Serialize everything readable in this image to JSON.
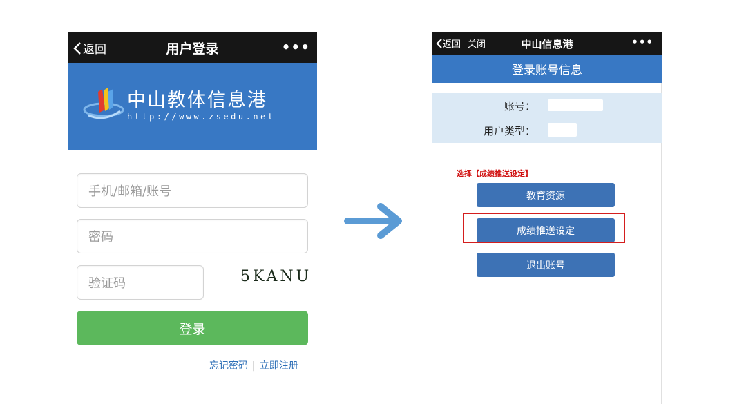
{
  "left_screen": {
    "nav": {
      "back_label": "返回",
      "title": "用户登录",
      "more": "•••"
    },
    "banner": {
      "brand": "中山教体信息港",
      "url": "http://www.zsedu.net"
    },
    "form": {
      "account_placeholder": "手机/邮箱/账号",
      "password_placeholder": "密码",
      "captcha_placeholder": "验证码",
      "captcha_text": "5KANU",
      "login_label": "登录"
    },
    "links": {
      "forgot": "忘记密码",
      "separator": "|",
      "register": "立即注册"
    }
  },
  "right_screen": {
    "nav": {
      "back_label": "返回",
      "close_label": "关闭",
      "title": "中山信息港",
      "more": "•••"
    },
    "header": "登录账号信息",
    "info": {
      "account_label": "账号：",
      "user_type_label": "用户类型："
    },
    "hint": "选择【成绩推送设定】",
    "buttons": {
      "edu_resources": "教育资源",
      "score_push": "成绩推送设定",
      "logout": "退出账号"
    }
  },
  "colors": {
    "nav_bg": "#161616",
    "brand_blue": "#3878c4",
    "login_green": "#5cb85c",
    "highlight_red": "#d41e1e"
  }
}
